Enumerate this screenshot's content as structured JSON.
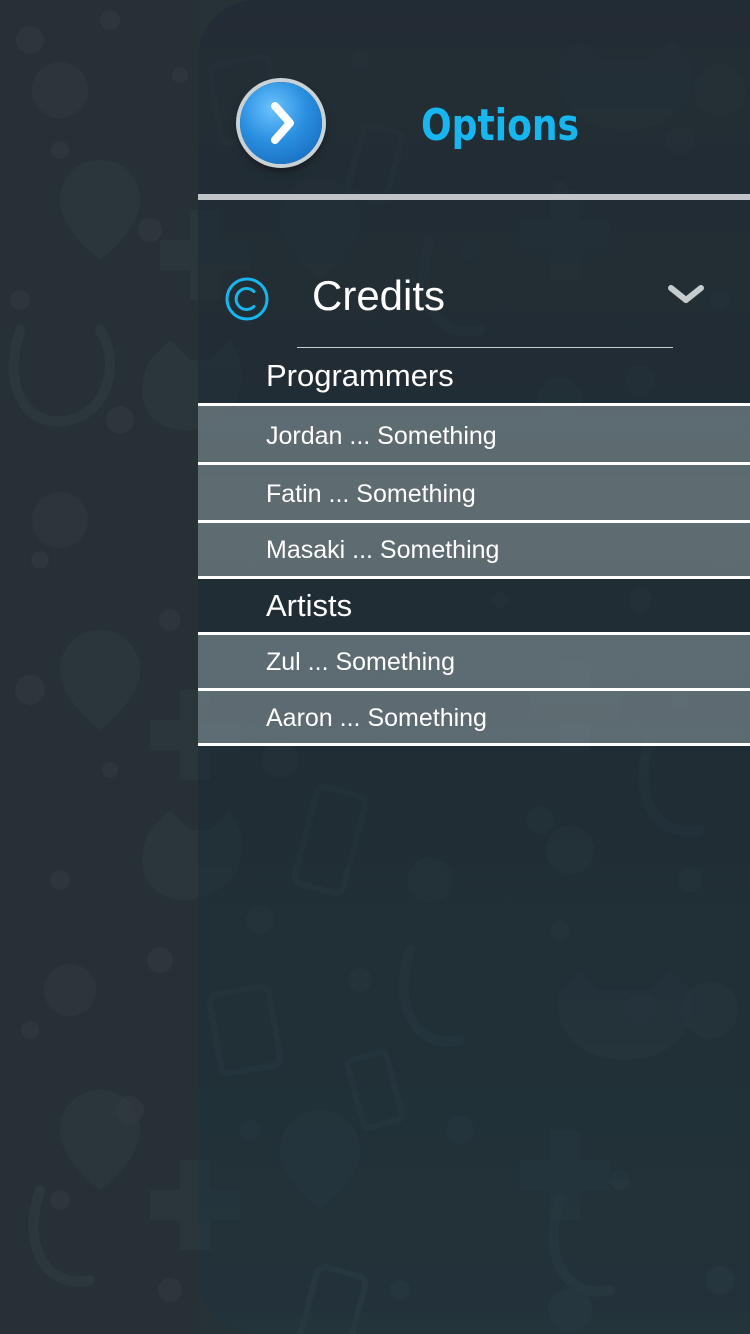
{
  "header": {
    "title": "Options",
    "back_icon": "chevron-right-icon"
  },
  "credits": {
    "title": "Credits",
    "icon": "copyright-icon",
    "toggle_icon": "chevron-down-icon",
    "programmers_label": "Programmers",
    "programmers": [
      "Jordan ... Something",
      "Fatin ... Something",
      "Masaki ... Something"
    ],
    "artists_label": "Artists",
    "artists": [
      "Zul ... Something",
      "Aaron ... Something"
    ]
  },
  "colors": {
    "accent": "#17b6ef",
    "button_blue": "#2a8fe0",
    "background": "#273236"
  }
}
